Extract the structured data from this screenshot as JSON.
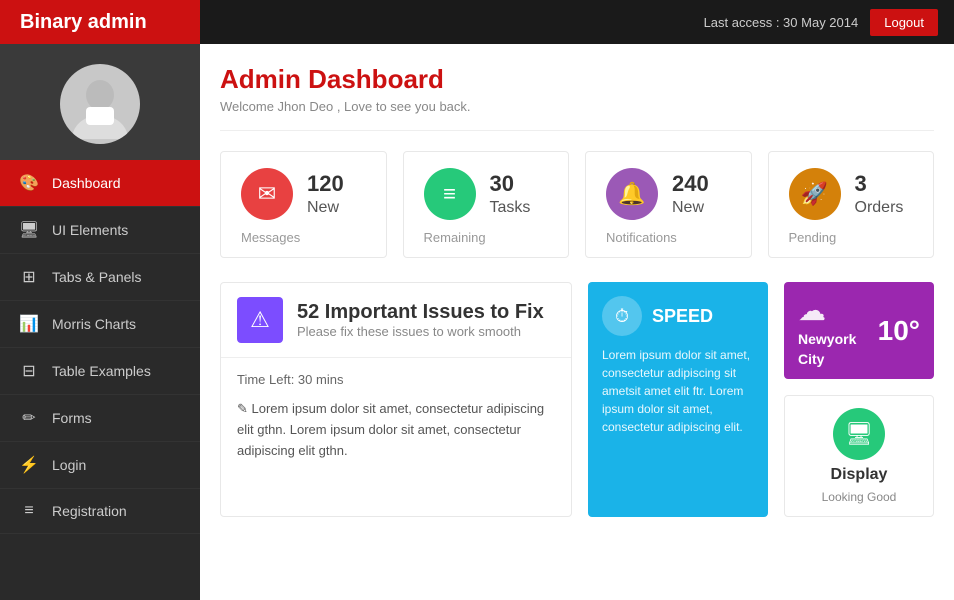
{
  "topbar": {
    "brand": "Binary admin",
    "last_access": "Last access : 30 May 2014",
    "logout_label": "Logout"
  },
  "sidebar": {
    "nav_items": [
      {
        "id": "dashboard",
        "label": "Dashboard",
        "icon": "🎨",
        "active": true
      },
      {
        "id": "ui-elements",
        "label": "UI Elements",
        "icon": "🖥",
        "active": false
      },
      {
        "id": "tabs-panels",
        "label": "Tabs & Panels",
        "icon": "⊞",
        "active": false
      },
      {
        "id": "morris-charts",
        "label": "Morris Charts",
        "icon": "📊",
        "active": false
      },
      {
        "id": "table-examples",
        "label": "Table Examples",
        "icon": "⊟",
        "active": false
      },
      {
        "id": "forms",
        "label": "Forms",
        "icon": "✏",
        "active": false
      },
      {
        "id": "login",
        "label": "Login",
        "icon": "⚡",
        "active": false
      },
      {
        "id": "registration",
        "label": "Registration",
        "icon": "≡",
        "active": false
      }
    ]
  },
  "main": {
    "page_title": "Admin Dashboard",
    "page_subtitle": "Welcome Jhon Deo , Love to see you back.",
    "stats": [
      {
        "count": "120",
        "label_top": "New",
        "label_bottom": "Messages",
        "icon": "✉",
        "color": "#e84141"
      },
      {
        "count": "30",
        "label_top": "Tasks",
        "label_bottom": "Remaining",
        "icon": "≡",
        "color": "#26c97a"
      },
      {
        "count": "240",
        "label_top": "New",
        "label_bottom": "Notifications",
        "icon": "🔔",
        "color": "#9b59b6"
      },
      {
        "count": "3",
        "label_top": "Orders",
        "label_bottom": "Pending",
        "icon": "🚀",
        "color": "#d4810a"
      }
    ],
    "alert": {
      "count": "52 Important Issues to Fix",
      "subtitle": "Please fix these issues to work smooth",
      "time_left": "Time Left: 30 mins",
      "body_text": "Lorem ipsum dolor sit amet, consectetur adipiscing elit gthn. Lorem ipsum dolor sit amet, consectetur adipiscing elit gthn."
    },
    "speed": {
      "title": "SPEED",
      "text": "Lorem ipsum dolor sit amet, consectetur adipiscing sit ametsit amet elit ftr. Lorem ipsum dolor sit amet, consectetur adipiscing elit."
    },
    "weather": {
      "temp": "10°",
      "city_line1": "Newyork",
      "city_line2": "City"
    },
    "display": {
      "title": "Display",
      "subtitle": "Looking Good"
    }
  }
}
